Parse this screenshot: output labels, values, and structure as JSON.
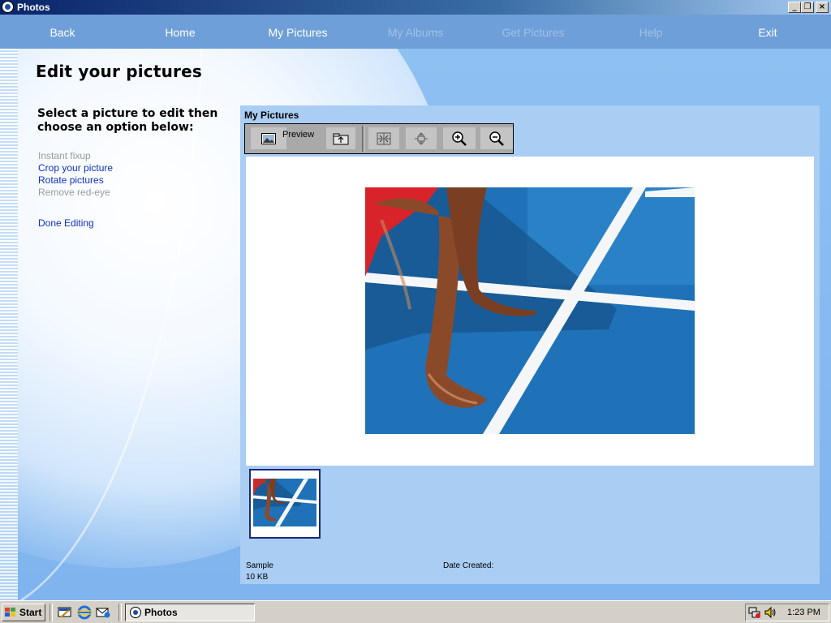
{
  "window": {
    "title": "Photos"
  },
  "nav": {
    "items": [
      {
        "label": "Back",
        "enabled": true
      },
      {
        "label": "Home",
        "enabled": true
      },
      {
        "label": "My Pictures",
        "enabled": true
      },
      {
        "label": "My Albums",
        "enabled": false
      },
      {
        "label": "Get Pictures",
        "enabled": false
      },
      {
        "label": "Help",
        "enabled": false
      },
      {
        "label": "Exit",
        "enabled": true
      }
    ]
  },
  "page": {
    "title": "Edit your pictures",
    "instruction": "Select a picture to edit then choose an option below:",
    "options": [
      {
        "label": "Instant fixup",
        "enabled": false
      },
      {
        "label": "Crop your picture",
        "enabled": true
      },
      {
        "label": "Rotate pictures",
        "enabled": true
      },
      {
        "label": "Remove red-eye",
        "enabled": false
      }
    ],
    "done_label": "Done Editing"
  },
  "panel": {
    "title": "My Pictures",
    "toolbar": {
      "preview_label": "Preview",
      "icons": [
        "picture-icon",
        "folder-up-icon",
        "fit-to-window-icon",
        "actual-size-icon",
        "zoom-in-icon",
        "zoom-out-icon"
      ]
    },
    "selected_file": {
      "name": "Sample",
      "size": "10 KB",
      "date_label": "Date Created:"
    }
  },
  "taskbar": {
    "start_label": "Start",
    "task_label": "Photos",
    "clock": "1:23 PM"
  },
  "colors": {
    "nav_bg": "#6f9fd8",
    "panel_bg": "#a9cdf3",
    "link": "#1030c0",
    "disabled": "#9a9a9a"
  }
}
